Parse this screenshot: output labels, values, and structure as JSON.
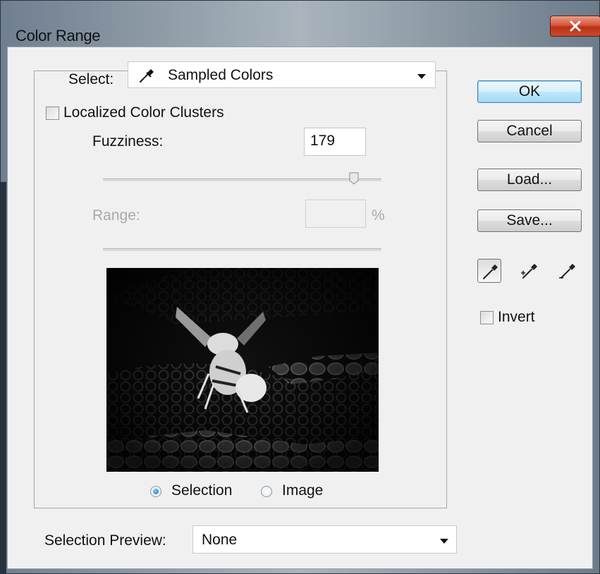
{
  "window": {
    "title": "Color Range",
    "close_label": "x"
  },
  "select": {
    "label": "Select:",
    "value": "Sampled Colors",
    "icon": "eyedropper-icon"
  },
  "localized_clusters": {
    "label": "Localized Color Clusters",
    "checked": false
  },
  "fuzziness": {
    "label": "Fuzziness:",
    "value": "179",
    "slider_fraction": 0.9
  },
  "range": {
    "label": "Range:",
    "value": "",
    "unit": "%",
    "enabled": false
  },
  "preview_mode": {
    "options": [
      "Selection",
      "Image"
    ],
    "selected": "Selection"
  },
  "selection_preview": {
    "label": "Selection Preview:",
    "value": "None"
  },
  "buttons": {
    "ok": "OK",
    "cancel": "Cancel",
    "load": "Load...",
    "save": "Save..."
  },
  "tools": [
    "eyedropper-icon",
    "eyedropper-plus-icon",
    "eyedropper-minus-icon"
  ],
  "invert": {
    "label": "Invert",
    "checked": false
  },
  "colors": {
    "close_red": "#c94a2c",
    "ok_blue": "#3c7fb1",
    "dialog_bg": "#f0f0f0"
  }
}
